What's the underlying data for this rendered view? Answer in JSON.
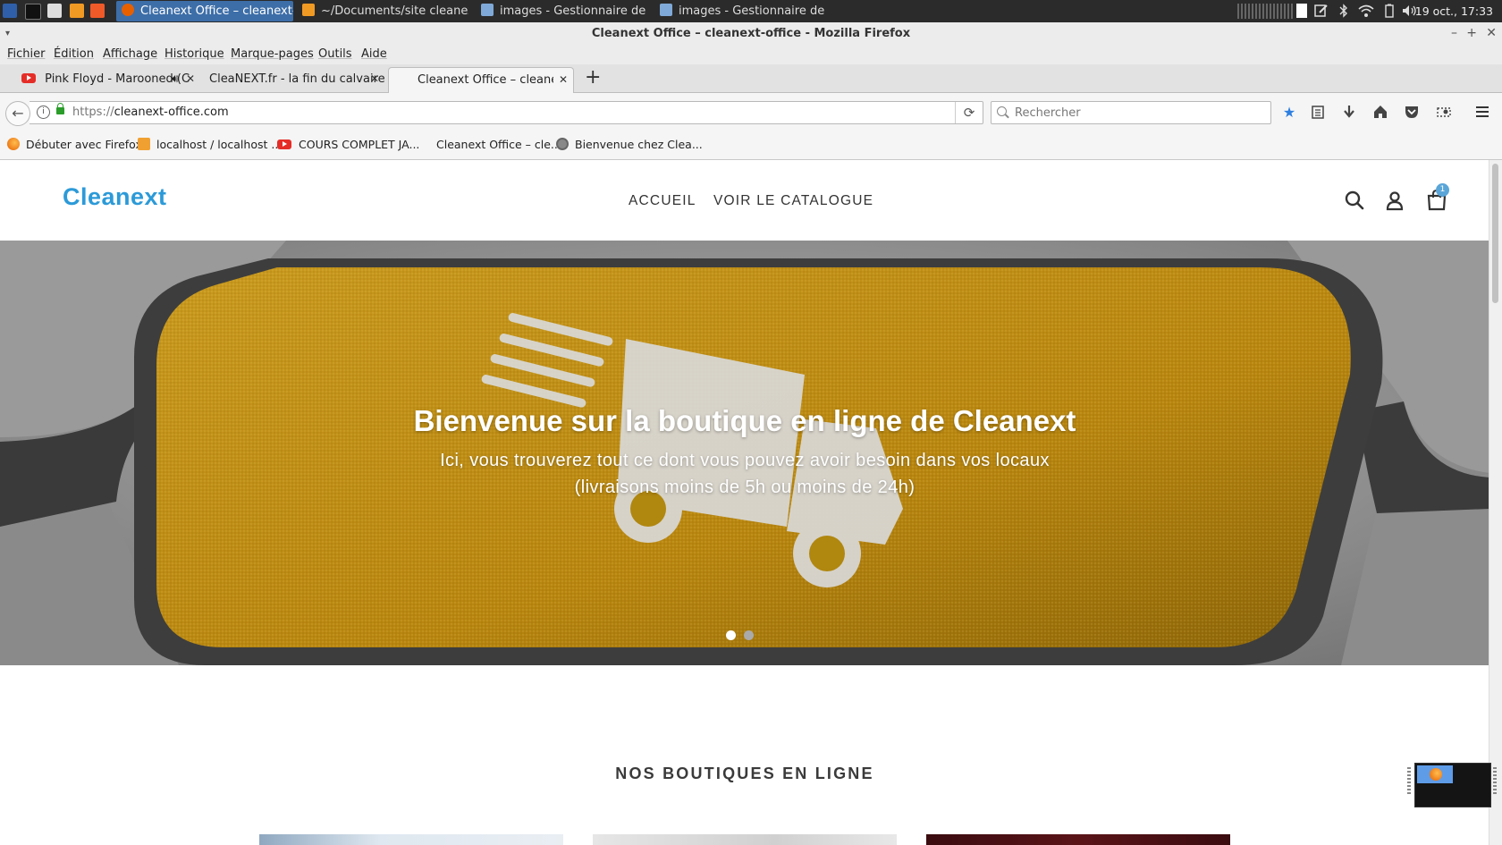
{
  "taskbar": {
    "windows": [
      {
        "label": "Cleanext Office – cleanext-o...",
        "active": true
      },
      {
        "label": "~/Documents/site cleanext/..."
      },
      {
        "label": "images - Gestionnaire de fic..."
      },
      {
        "label": "images - Gestionnaire de fic..."
      }
    ],
    "clock": "19 oct., 17:33"
  },
  "window": {
    "title": "Cleanext Office – cleanext-office - Mozilla Firefox"
  },
  "menu": [
    "Fichier",
    "Édition",
    "Affichage",
    "Historique",
    "Marque-pages",
    "Outils",
    "Aide"
  ],
  "tabs": [
    {
      "label": "Pink Floyd - Marooned (C",
      "icon": "youtube-icon"
    },
    {
      "label": "CleaNEXT.fr - la fin du calvaire"
    },
    {
      "label": "Cleanext Office – cleanext-c",
      "active": true
    }
  ],
  "navigation": {
    "url_prefix": "https://",
    "url_host": "cleanext-office.com",
    "search_placeholder": "Rechercher"
  },
  "bookmarks": [
    {
      "label": "Débuter avec Firefox",
      "icon": "firefox-icon"
    },
    {
      "label": "localhost / localhost ...",
      "icon": "phpmyadmin-icon"
    },
    {
      "label": "COURS COMPLET JA...",
      "icon": "youtube-icon"
    },
    {
      "label": "Cleanext Office – cle...",
      "icon": "none"
    },
    {
      "label": "Bienvenue chez Clea...",
      "icon": "globe-icon"
    }
  ],
  "site": {
    "logo": "Cleanext",
    "nav": [
      "ACCUEIL",
      "VOIR LE CATALOGUE"
    ],
    "cart_count": "1",
    "hero": {
      "title": "Bienvenue sur la boutique en ligne de Cleanext",
      "subtitle": "Ici, vous trouverez tout ce dont vous pouvez avoir besoin dans vos locaux (livraisons moins de 5h ou moins de 24h)",
      "slide_count": 2,
      "active_slide": 1
    },
    "section_title": "NOS BOUTIQUES EN LIGNE"
  },
  "colors": {
    "brand": "#2c9ad8",
    "taskbar": "#2b2b2b",
    "active_window": "#3d6ea8"
  }
}
